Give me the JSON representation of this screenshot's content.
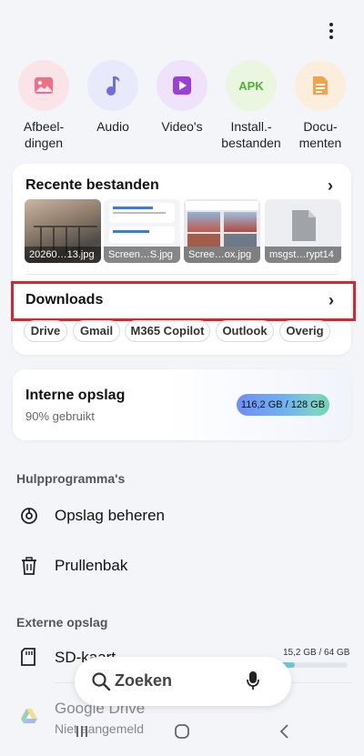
{
  "categories": [
    {
      "label": "Afbeel-\ndingen",
      "icon": "image-icon"
    },
    {
      "label": "Audio",
      "icon": "music-note-icon"
    },
    {
      "label": "Video's",
      "icon": "video-icon"
    },
    {
      "label": "Install.-\nbestanden",
      "icon": "apk-icon",
      "icon_text": "APK"
    },
    {
      "label": "Docu-\nmenten",
      "icon": "document-icon"
    }
  ],
  "recent": {
    "title": "Recente bestanden",
    "files": [
      {
        "name": "20260…13.jpg"
      },
      {
        "name": "Screen…S.jpg"
      },
      {
        "name": "Scree…ox.jpg"
      },
      {
        "name": "msgst…rypt14"
      }
    ]
  },
  "downloads": {
    "title": "Downloads",
    "chips": [
      "Drive",
      "Gmail",
      "M365 Copilot",
      "Outlook",
      "Overig"
    ]
  },
  "internal": {
    "title": "Interne opslag",
    "subtitle": "90% gebruikt",
    "usage": "116,2 GB  / 128 GB",
    "used_fraction": 0.91
  },
  "tools": {
    "heading": "Hulpprogramma's",
    "items": [
      {
        "label": "Opslag beheren",
        "icon": "storage-manage-icon"
      },
      {
        "label": "Prullenbak",
        "icon": "trash-icon"
      }
    ]
  },
  "external": {
    "heading": "Externe opslag",
    "sd": {
      "label": "SD-kaart",
      "usage": "15,2 GB / 64 GB",
      "used_fraction": 0.24
    },
    "drive": {
      "label": "Google Drive",
      "subtitle": "Niet aangemeld"
    }
  },
  "search": {
    "label": "Zoeken"
  },
  "colors": {
    "accent_red": "#d8262d",
    "background": "#f4f5f9"
  }
}
